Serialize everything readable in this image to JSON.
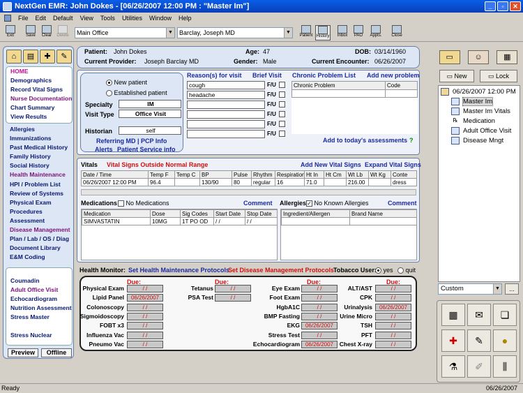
{
  "window": {
    "title": "NextGen EMR: John Dokes - [06/26/2007 12:00 PM : \"Master Im\"]"
  },
  "menu": [
    "File",
    "Edit",
    "Default",
    "View",
    "Tools",
    "Utilities",
    "Window",
    "Help"
  ],
  "toolbar": {
    "exit": "Exit",
    "save": "Save",
    "clear": "Clear",
    "delete": "Delete",
    "location": "Main Office",
    "provider": "Barclay, Joseph  MD",
    "patient": "Patient",
    "history": "History",
    "inbox": "Inbox",
    "pao": "PAO",
    "appts": "Appts.",
    "close": "Close"
  },
  "nav": {
    "top": [
      "HOME",
      "Demographics",
      "Record Vital Signs",
      "Nurse Documentation",
      "Chart Summary",
      "View Results"
    ],
    "mid": [
      "Allergies",
      "Immunizations",
      "Past Medical History",
      "Family History",
      "Social History",
      "Health Maintenance",
      "HPI  /  Problem List",
      "Review of Systems",
      "Physical Exam",
      "Procedures",
      "Assessment",
      "Disease Management",
      "Plan / Lab  / OS / Diag",
      "Document Library",
      "E&M Coding"
    ],
    "bottom": [
      "Coumadin",
      "Adult Office Visit",
      "Echocardiogram",
      "Nutrition Assessment",
      "Stress Master",
      "",
      "Stress Nuclear"
    ],
    "preview": "Preview",
    "offline": "Offline"
  },
  "header": {
    "patient_lbl": "Patient:",
    "patient": "John Dokes",
    "age_lbl": "Age:",
    "age": "47",
    "dob_lbl": "DOB:",
    "dob": "03/14/1960",
    "provider_lbl": "Current Provider:",
    "provider": "Joseph Barclay MD",
    "gender_lbl": "Gender:",
    "gender": "Male",
    "encounter_lbl": "Current Encounter:",
    "encounter": "06/26/2007"
  },
  "visit": {
    "new_patient": "New patient",
    "established": "Established patient",
    "specialty_lbl": "Specialty",
    "specialty": "IM",
    "type_lbl": "Visit Type",
    "type": "Office Visit",
    "historian_lbl": "Historian",
    "historian": "self",
    "referring": "Referring MD | PCP Info",
    "alerts": "Alerts",
    "psi": "Patient Service info"
  },
  "reasons": {
    "title": "Reason(s) for visit",
    "brief": "Brief Visit",
    "fu": "F/U",
    "items": [
      "cough",
      "headache",
      "",
      "",
      "",
      ""
    ]
  },
  "chronic": {
    "title": "Chronic Problem List",
    "add": "Add new problem",
    "col1": "Chronic Problem",
    "col2": "Code",
    "add_assess": "Add to today's assessments",
    "q": "?"
  },
  "vitals": {
    "title": "Vitals",
    "outside": "Vital Signs Outside Normal Range",
    "add": "Add New Vital Signs",
    "expand": "Expand Vital Signs",
    "headers": [
      "Date / Time",
      "Temp F",
      "Temp C",
      "BP",
      "Pulse",
      "Rhythm",
      "Respiration",
      "Ht In",
      "Ht Cm",
      "Wt Lb",
      "Wt Kg",
      "Conte"
    ],
    "row": [
      "06/26/2007 12:00 PM",
      "96.4",
      "",
      "130/90",
      "80",
      "regular",
      "16",
      "71.0",
      "",
      "216.00",
      "",
      "dress"
    ]
  },
  "meds": {
    "title": "Medications",
    "none": "No Medications",
    "comment": "Comment",
    "headers": [
      "Medication",
      "Dose",
      "Sig Codes",
      "Start Date",
      "Stop Date"
    ],
    "row": [
      "SIMVASTATIN",
      "10MG",
      "1T PO OD",
      " / / ",
      " / / "
    ]
  },
  "allergies": {
    "title": "Allergies",
    "none": "No Known Allergies",
    "comment": "Comment",
    "headers": [
      "Ingredient/Allergen",
      "Brand Name"
    ]
  },
  "hm": {
    "title": "Health Monitor:",
    "set_hm": "Set Health Maintenance Protocols",
    "set_dm": "Set Disease Management Protocols",
    "tobacco": "Tobacco User:",
    "yes": "yes",
    "quit": "quit",
    "due": "Due:",
    "col1": [
      [
        "Physical Exam",
        " / / "
      ],
      [
        "Lipid Panel",
        "06/26/2007"
      ],
      [
        "Colonoscopy",
        " / / "
      ],
      [
        "Sigmoidoscopy",
        " / / "
      ],
      [
        "FOBT x3",
        " / / "
      ],
      [
        "Influenza Vac",
        " / / "
      ],
      [
        "Pneumo Vac",
        " / / "
      ]
    ],
    "col2": [
      [
        "Tetanus",
        " / / "
      ],
      [
        "PSA Test",
        " / / "
      ]
    ],
    "col3": [
      [
        "Eye Exam",
        " / / "
      ],
      [
        "Foot Exam",
        " / / "
      ],
      [
        "HgbA1C",
        " / / "
      ],
      [
        "BMP Fasting",
        " / / "
      ],
      [
        "EKG",
        "06/26/2007"
      ],
      [
        "Stress Test",
        " / / "
      ],
      [
        "Echocardiogram",
        "06/26/2007"
      ]
    ],
    "col4": [
      [
        "ALT/AST",
        " / / "
      ],
      [
        "CPK",
        " / / "
      ],
      [
        "Urinalysis",
        "06/26/2007"
      ],
      [
        "Urine Micro",
        " / / "
      ],
      [
        "TSH",
        " / / "
      ],
      [
        "PFT",
        " / / "
      ],
      [
        "Chest X-ray",
        " / / "
      ]
    ]
  },
  "right": {
    "new": "New",
    "lock": "Lock",
    "root": "06/26/2007 12:00 PM",
    "items": [
      "Master Im",
      "Master Im Vitals",
      "Medication",
      "Adult Office Visit",
      "Disease Mngt"
    ],
    "custom": "Custom",
    "more": "..."
  },
  "status": {
    "left": "Ready",
    "right": "06/26/2007"
  }
}
